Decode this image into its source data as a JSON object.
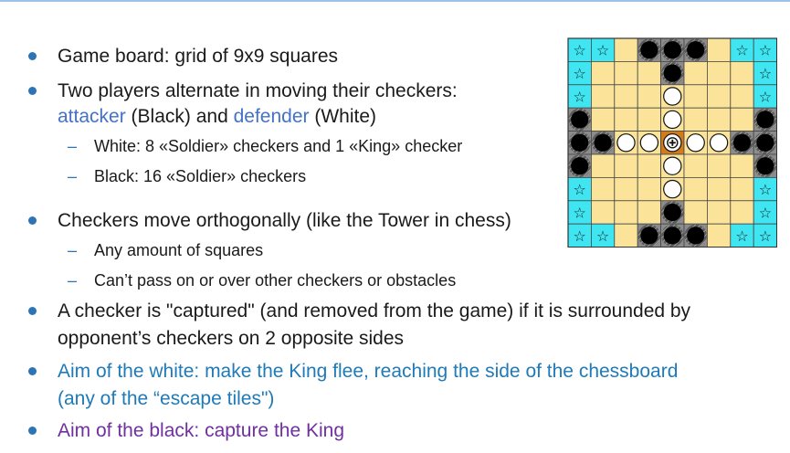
{
  "bullets": {
    "b1": "Game board: grid of 9x9 squares",
    "b2_line1": "Two players alternate in moving their checkers:",
    "b2_attacker": "attacker",
    "b2_black": " (Black) and ",
    "b2_defender": "defender",
    "b2_white": " (White)",
    "b2_sub1": "White: 8 «Soldier» checkers and 1 «King» checker",
    "b2_sub2": "Black: 16 «Soldier» checkers",
    "b3": "Checkers move orthogonally (like the Tower in chess)",
    "b3_sub1": "Any amount of squares",
    "b3_sub2": "Can’t pass on or over other checkers or obstacles",
    "b4_line1": "A checker is \"captured\" (and removed from the game) if it is surrounded by",
    "b4_line2": "opponent’s checkers on 2 opposite sides",
    "b5_line1": "Aim of the white: make the King flee, reaching the side of the chessboard",
    "b5_line2": "(any of the  “escape tiles\")",
    "b6": "Aim of the black: capture the King",
    "dash": "–"
  },
  "colors": {
    "tile": "#fbe49a",
    "escape": "#3fe6f2",
    "camp": "#8c8c8c",
    "throne": "#d17b1f",
    "bullet": "#2e74b5",
    "highlight": "#4472c4",
    "aim_white": "#1e7ab8",
    "aim_black": "#7030a0"
  },
  "board": {
    "size": 9,
    "cells": [
      "EE.CCC.EE",
      "E...C...E",
      "E.......E",
      "C.......C",
      "CC..T..CC",
      "C.......C",
      "E.......E",
      "E...C...E",
      "EE.CCC.EE"
    ],
    "pieces": [
      "...BBB...",
      "....B....",
      "....W....",
      "B...W...B",
      "BBWWKWWBB",
      "B...W...B",
      "....W....",
      "....B....",
      "...BBB..."
    ],
    "escape_symbol": "☆"
  }
}
